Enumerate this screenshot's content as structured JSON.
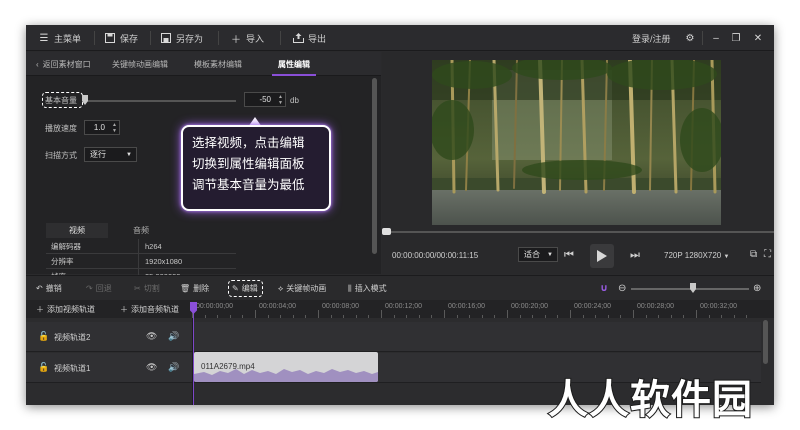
{
  "topbar": {
    "main_menu": "主菜单",
    "save": "保存",
    "save_as": "另存为",
    "import": "导入",
    "export": "导出",
    "login": "登录/注册"
  },
  "tabs": {
    "back": "返回素材窗口",
    "keyframe": "关键帧动画编辑",
    "template": "模板素材编辑",
    "property": "属性编辑"
  },
  "properties": {
    "volume_label": "基本音量",
    "volume_value": "-50",
    "volume_unit": "db",
    "volume_level": 0.0,
    "speed_label": "播放速度",
    "speed_value": "1.0",
    "scan_label": "扫描方式",
    "scan_value": "逐行"
  },
  "info": {
    "tab_video": "视频",
    "tab_audio": "音频",
    "rows": [
      {
        "key": "编解码器",
        "value": "h264"
      },
      {
        "key": "分辨率",
        "value": "1920x1080"
      },
      {
        "key": "帧率",
        "value": "25.000000"
      }
    ]
  },
  "callout": {
    "line1": "选择视频，点击编辑",
    "line2": "切换到属性编辑面板",
    "line3": "调节基本音量为最低"
  },
  "player": {
    "timecode": "00:00:00:00/00:00:11:15",
    "fit": "适合",
    "resolution": "720P 1280X720"
  },
  "toolbar": {
    "undo": "撤销",
    "redo": "回退",
    "cut": "切割",
    "delete": "删除",
    "edit": "编辑",
    "keyframe": "关键帧动画",
    "insert_mode": "插入模式",
    "add_video_track": "添加视频轨道",
    "add_audio_track": "添加音频轨道"
  },
  "ruler": [
    "00:00:00;00",
    "00:00:04;00",
    "00:00:08;00",
    "00:00:12;00",
    "00:00:16;00",
    "00:00:20;00",
    "00:00:24;00",
    "00:00:28;00",
    "00:00:32;00"
  ],
  "tracks": [
    {
      "name": "视频轨道2"
    },
    {
      "name": "视频轨道1"
    }
  ],
  "clip": {
    "name": "011A2679.mp4"
  },
  "watermark": "人人软件园",
  "colors": {
    "accent": "#8a4fd8",
    "background": "#2a2a2c"
  }
}
